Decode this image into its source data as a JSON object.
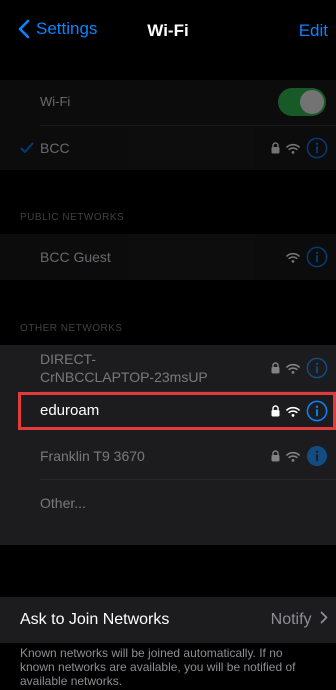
{
  "nav": {
    "back_label": "Settings",
    "title": "Wi-Fi",
    "edit_label": "Edit"
  },
  "wifi": {
    "toggle_label": "Wi-Fi",
    "toggle_on": true,
    "connected_network": "BCC"
  },
  "public_networks": {
    "header": "PUBLIC NETWORKS",
    "items": [
      {
        "name": "BCC Guest"
      }
    ]
  },
  "other_networks": {
    "header": "OTHER NETWORKS",
    "items": [
      {
        "name_line1": "DIRECT-",
        "name_line2": "CrNBCCLAPTOP-23msUP"
      },
      {
        "name": "eduroam"
      },
      {
        "name": "Franklin T9 3670"
      },
      {
        "name": "Other..."
      }
    ]
  },
  "ask_to_join": {
    "label": "Ask to Join Networks",
    "value": "Notify"
  },
  "footer_text": "Known networks will be joined automatically. If no known networks are available, you will be notified of available networks.",
  "colors": {
    "accent": "#0a84ff",
    "toggle_on": "#34c759",
    "highlight": "#e23b3b",
    "background": "#000000",
    "cell": "#1c1c1e"
  },
  "icons": [
    "chevron-left-icon",
    "checkmark-icon",
    "lock-icon",
    "wifi-icon",
    "info-icon",
    "chevron-right-icon"
  ]
}
